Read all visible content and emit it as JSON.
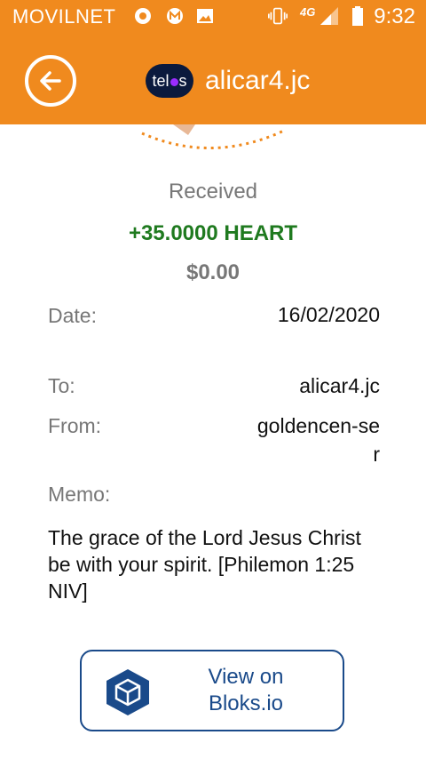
{
  "status_bar": {
    "carrier": "MOVILNET",
    "network": "4G",
    "time": "9:32"
  },
  "header": {
    "logo_text_left": "tel",
    "logo_text_right": "s",
    "account": "alicar4.jc"
  },
  "transaction": {
    "direction": "Received",
    "amount": "+35.0000 HEART",
    "fiat": "$0.00",
    "date_label": "Date:",
    "date_value": "16/02/2020",
    "to_label": "To:",
    "to_value": "alicar4.jc",
    "from_label": "From:",
    "from_value": "goldencen-ser",
    "memo_label": "Memo:",
    "memo_text": "The grace of the Lord Jesus Christ be with your spirit. [Philemon 1:25 NIV]"
  },
  "actions": {
    "view_on_bloks": "View on Bloks.io"
  },
  "colors": {
    "brand_orange": "#f08a1e",
    "amount_green": "#1f7a1f",
    "bloks_blue": "#1a4a8a"
  },
  "icons": [
    "chrome-icon",
    "mail-m-icon",
    "image-icon",
    "vibrate-icon",
    "signal-icon",
    "battery-icon",
    "back-arrow-icon",
    "bloks-cube-icon"
  ]
}
